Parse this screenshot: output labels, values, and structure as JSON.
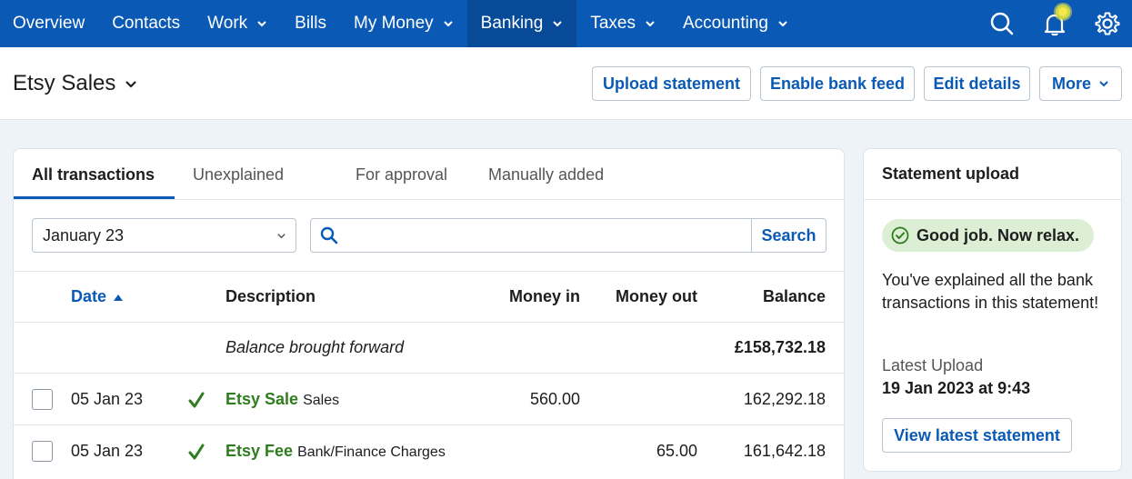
{
  "nav": {
    "items": [
      {
        "label": "Overview",
        "dropdown": false,
        "active": false
      },
      {
        "label": "Contacts",
        "dropdown": false,
        "active": false
      },
      {
        "label": "Work",
        "dropdown": true,
        "active": false
      },
      {
        "label": "Bills",
        "dropdown": false,
        "active": false
      },
      {
        "label": "My Money",
        "dropdown": true,
        "active": false
      },
      {
        "label": "Banking",
        "dropdown": true,
        "active": true
      },
      {
        "label": "Taxes",
        "dropdown": true,
        "active": false
      },
      {
        "label": "Accounting",
        "dropdown": true,
        "active": false
      }
    ],
    "icons": [
      "search-icon",
      "bell-icon",
      "gear-icon"
    ]
  },
  "header": {
    "account_name": "Etsy Sales",
    "buttons": {
      "upload": "Upload statement",
      "feed": "Enable bank feed",
      "edit": "Edit details",
      "more": "More"
    }
  },
  "transactions": {
    "tabs": [
      "All transactions",
      "Unexplained",
      "For approval",
      "Manually added"
    ],
    "active_tab": "All transactions",
    "period_select": "January 23",
    "search": {
      "value": "",
      "placeholder": "",
      "button": "Search"
    },
    "columns": {
      "date": "Date",
      "description": "Description",
      "money_in": "Money in",
      "money_out": "Money out",
      "balance": "Balance"
    },
    "sort": {
      "column": "Date",
      "direction": "ascending"
    },
    "brought_forward": {
      "label": "Balance brought forward",
      "balance": "£158,732.18"
    },
    "rows": [
      {
        "date": "05 Jan 23",
        "explained": true,
        "name": "Etsy Sale",
        "category": "Sales",
        "money_in": "560.00",
        "money_out": "",
        "balance": "162,292.18"
      },
      {
        "date": "05 Jan 23",
        "explained": true,
        "name": "Etsy Fee",
        "category": "Bank/Finance Charges",
        "money_in": "",
        "money_out": "65.00",
        "balance": "161,642.18"
      }
    ]
  },
  "statement": {
    "title": "Statement upload",
    "status": "Good job. Now relax.",
    "message": "You've explained all the bank transactions in this statement!",
    "latest_label": "Latest Upload",
    "latest_value": "19 Jan 2023 at 9:43",
    "button": "View latest statement"
  },
  "colors": {
    "nav_bg": "#0a5ab5",
    "nav_active_bg": "#074a98",
    "link": "#0a5ab5",
    "success_text": "#2e7d1f",
    "success_pill": "#dcefd4"
  }
}
